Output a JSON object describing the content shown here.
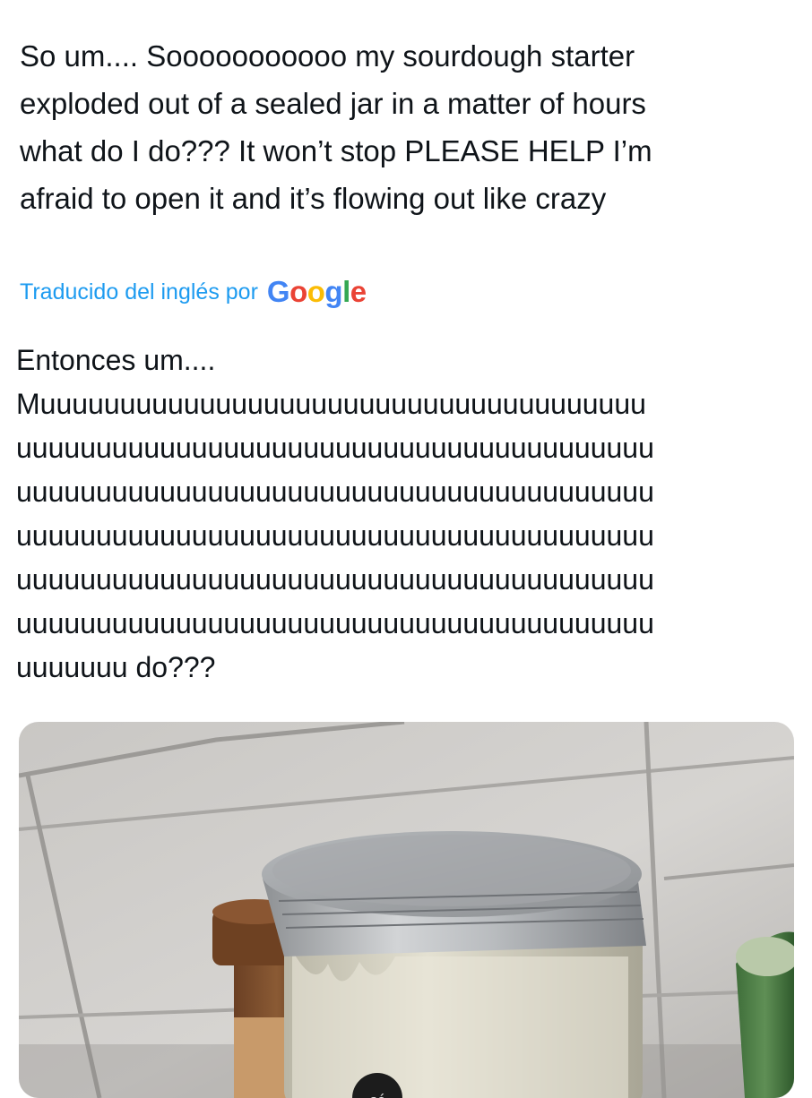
{
  "tweet": {
    "original_text": "So um.... Sooooooooooo my sourdough starter\nexploded out of a sealed jar in a matter of hours\nwhat do I do??? It won’t stop PLEASE HELP I’m\nafraid to open it and it’s flowing out like crazy",
    "translated_by_label": "Traducido del inglés por",
    "translation_provider": {
      "letters": [
        "G",
        "o",
        "o",
        "g",
        "l",
        "e"
      ]
    },
    "translation_text": "Entonces um....\nMuuuuuuuuuuuuuuuuuuuuuuuuuuuuuuuuuuuuuu\nuuuuuuuuuuuuuuuuuuuuuuuuuuuuuuuuuuuuuuuu\nuuuuuuuuuuuuuuuuuuuuuuuuuuuuuuuuuuuuuuuu\nuuuuuuuuuuuuuuuuuuuuuuuuuuuuuuuuuuuuuuuu\nuuuuuuuuuuuuuuuuuuuuuuuuuuuuuuuuuuuuuuuu\nuuuuuuuuuuuuuuuuuuuuuuuuuuuuuuuuuuuuuuuu\nuuuuuuu do???"
  },
  "colors": {
    "text": "#0f1419",
    "link": "#1d9bf0",
    "google_blue": "#4285f4",
    "google_red": "#ea4335",
    "google_yellow": "#fbbc05",
    "google_green": "#34a853"
  },
  "media": {
    "photo_label": "cé"
  }
}
